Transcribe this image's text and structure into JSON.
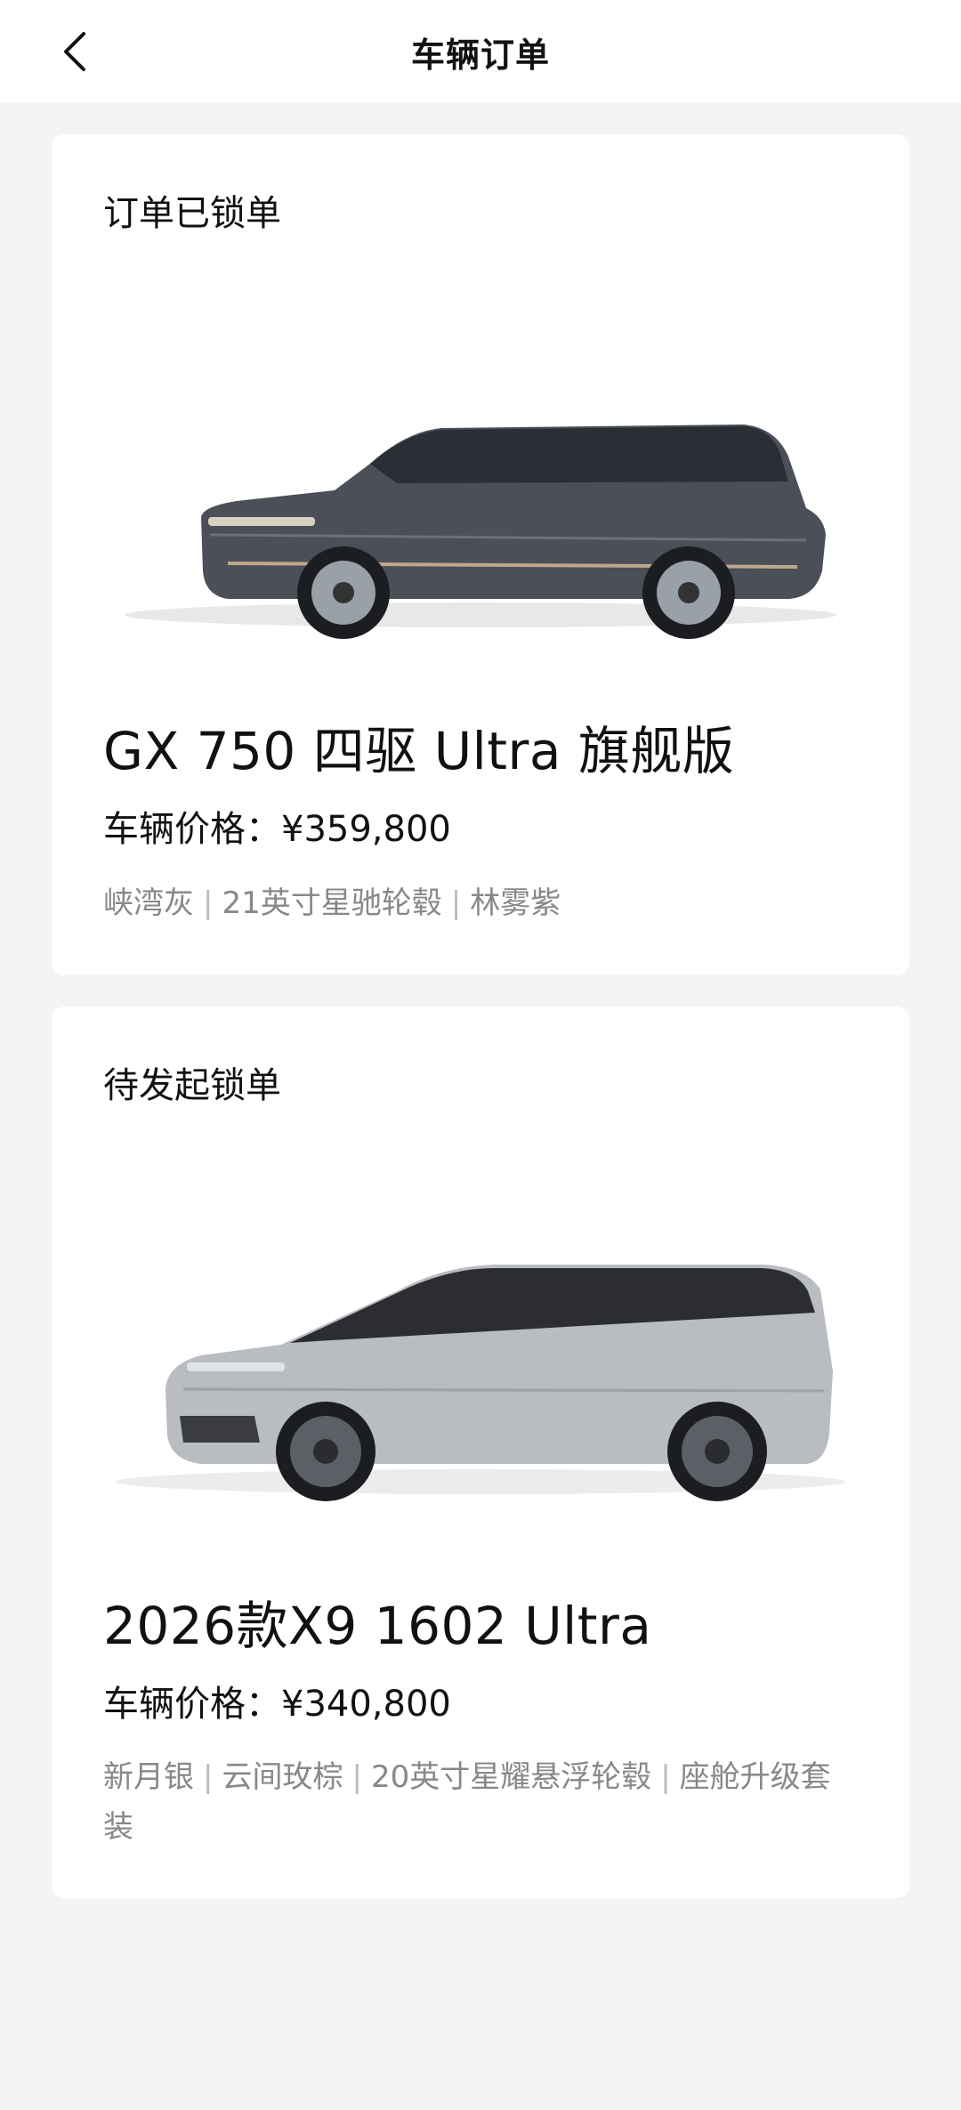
{
  "header": {
    "title": "车辆订单",
    "back_icon": "chevron-left-icon"
  },
  "orders": [
    {
      "status": "订单已锁单",
      "model": "GX 750 四驱 Ultra 旗舰版",
      "price_label": "车辆价格：",
      "price_value": "¥359,800",
      "options": [
        "峡湾灰",
        "21英寸星驰轮毂",
        "林雾紫"
      ],
      "image": "suv-image",
      "body_color": "#4a4f58"
    },
    {
      "status": "待发起锁单",
      "model": "2026款X9 1602 Ultra",
      "price_label": "车辆价格：",
      "price_value": "¥340,800",
      "options": [
        "新月银",
        "云间玫棕",
        "20英寸星耀悬浮轮毂",
        "座舱升级套装"
      ],
      "image": "mpv-image",
      "body_color": "#b9bcc1"
    }
  ]
}
